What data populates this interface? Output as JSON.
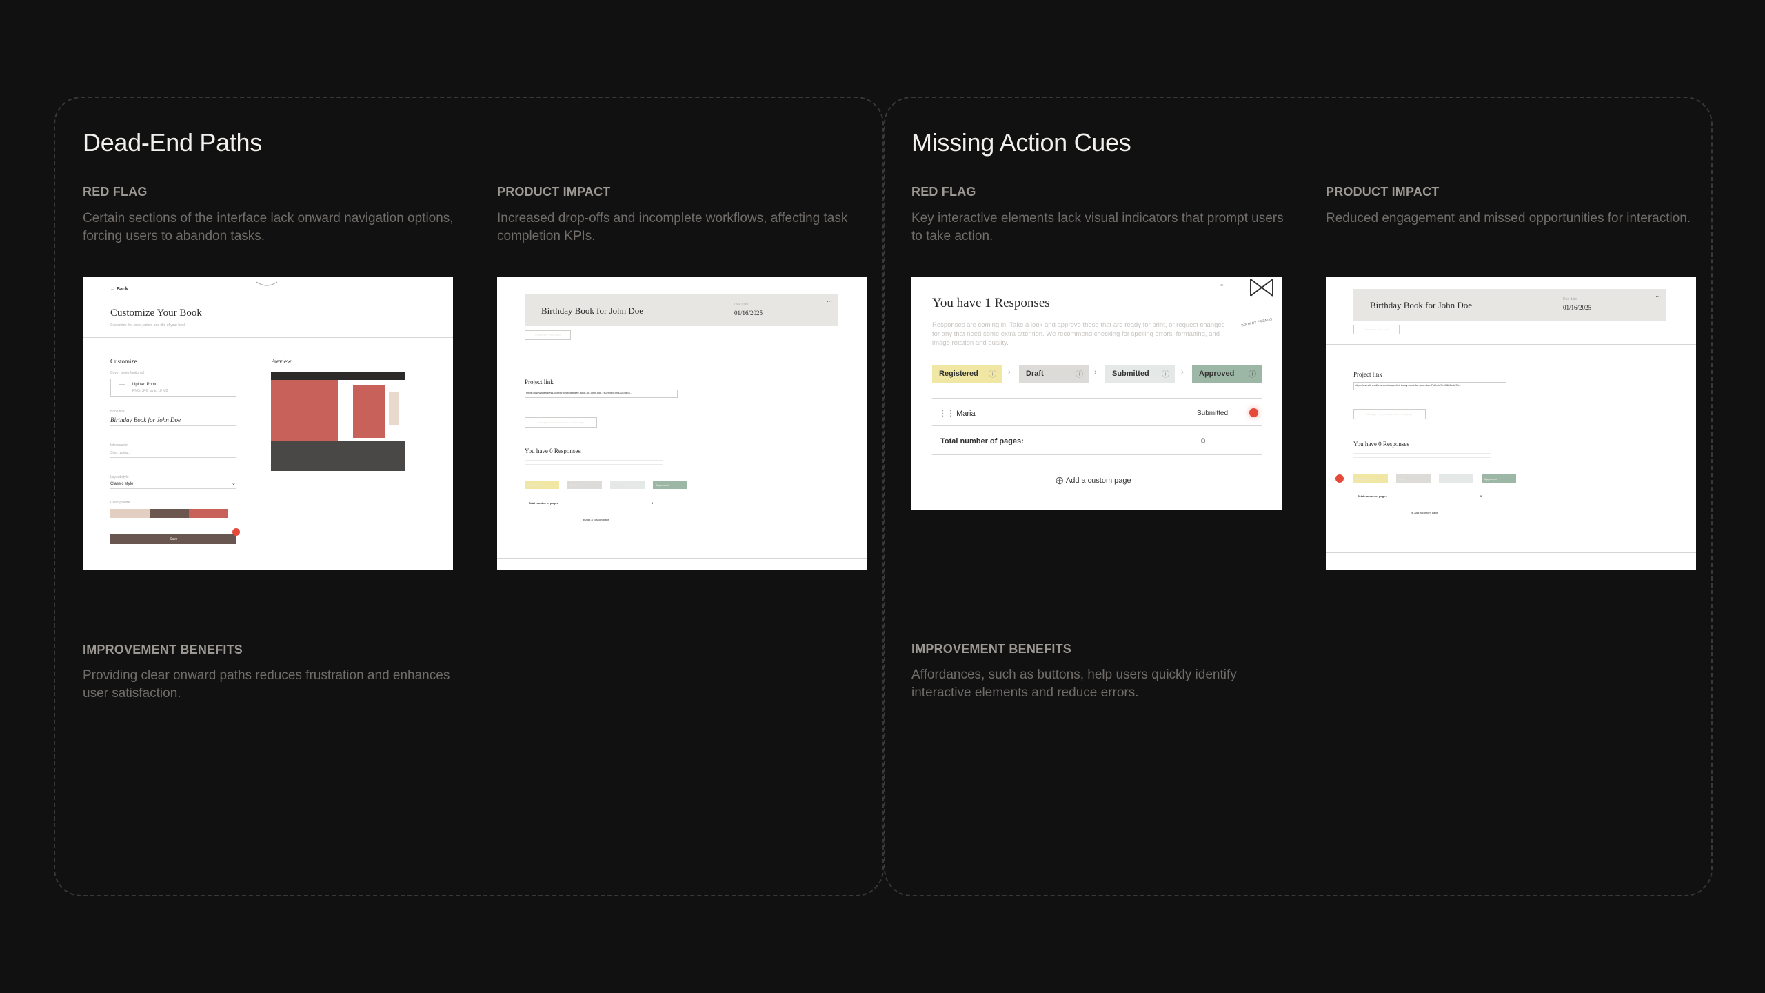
{
  "colors": {
    "background": "#121111",
    "accent_red": "#e5493a",
    "registered": "#f1e7a5",
    "draft": "#dddbd7",
    "submitted": "#e4e8e6",
    "approved": "#9cb7a5"
  },
  "left": {
    "title": "Dead-End Paths",
    "red_flag": {
      "label": "RED FLAG",
      "text": "Certain sections of the interface lack onward navigation options, forcing users to abandon tasks."
    },
    "product_impact": {
      "label": "PRODUCT IMPACT",
      "text": "Increased drop-offs and incomplete workflows, affecting task completion KPIs."
    },
    "improvement": {
      "label": "IMPROVEMENT BENEFITS",
      "text": "Providing clear onward paths reduces frustration and enhances user satisfaction."
    },
    "shot1": {
      "back": "Back",
      "title": "Customize Your Book",
      "subtitle": "Customize the cover, colors and title of your book",
      "customize": "Customize",
      "preview": "Preview",
      "cover_label": "Cover photo (optional)",
      "upload": "Upload Photo",
      "upload_hint": "PNG, JPG up to 10 MB",
      "book_title_label": "Book title",
      "book_title": "Birthday Book for John Doe",
      "intro_label": "Introduction",
      "intro_placeholder": "Start typing...",
      "style_label": "Layout style",
      "style_value": "Classic style",
      "colors_label": "Color palette",
      "save": "Save"
    },
    "shot2": {
      "book_title": "Birthday Book for John Doe",
      "due_label": "Due date",
      "due": "01/16/2025",
      "customize_btn": "Customize your book",
      "project_link": "Project link",
      "url": "https://usewithendless.com/project/birthday-book-for-john-doe-7b2b0d7e49826c4d78...",
      "manage_btn": "Manage your prompts and invite page",
      "responses": "You have 0 Responses",
      "statuses": [
        "Registered",
        "Draft",
        "Submitted",
        "Approved"
      ],
      "total": "Total number of pages",
      "total_value": "0",
      "add_page": "Add a custom page"
    }
  },
  "right": {
    "title": "Missing Action Cues",
    "red_flag": {
      "label": "RED FLAG",
      "text": "Key interactive elements lack visual indicators that prompt users to take action."
    },
    "product_impact": {
      "label": "PRODUCT IMPACT",
      "text": "Reduced engagement and missed opportunities for interaction."
    },
    "improvement": {
      "label": "IMPROVEMENT BENEFITS",
      "text": "Affordances, such as buttons, help users quickly identify interactive elements and reduce errors."
    },
    "shot3": {
      "responses": "You have 1 Responses",
      "desc": "Responses are coming in! Take a look and approve those that are ready for print, or request changes for any that need some extra attention. We recommend checking for spelling errors, formatting, and image rotation and quality.",
      "stamp": "BOOK BY FRIENDS",
      "statuses": [
        "Registered",
        "Draft",
        "Submitted",
        "Approved"
      ],
      "row_name": "Maria",
      "row_status": "Submitted",
      "total": "Total number of pages:",
      "total_value": "0",
      "add_page": "Add a custom page"
    },
    "shot4": {
      "book_title": "Birthday Book for John Doe",
      "due_label": "Due date",
      "due": "01/16/2025",
      "customize_btn": "Customize your book",
      "project_link": "Project link",
      "url": "https://usewithendless.com/project/birthday-book-for-john-doe-7b2b0d7e49826c4d78...",
      "manage_btn": "Manage your prompts and invite page",
      "responses": "You have 0 Responses",
      "statuses": [
        "Registered",
        "Draft",
        "Submitted",
        "Approved"
      ],
      "total": "Total number of pages",
      "total_value": "0",
      "add_page": "Add a custom page"
    }
  }
}
